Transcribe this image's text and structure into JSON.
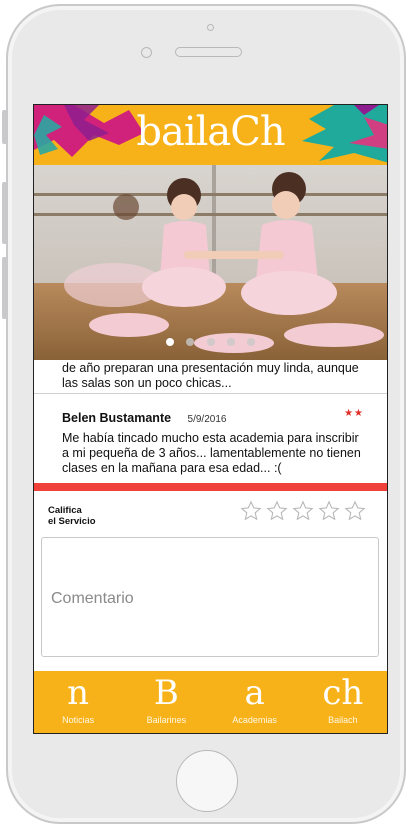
{
  "app": {
    "logo_text": "bailaCh",
    "brand_color": "#f7b219",
    "accent_red": "#f0413a"
  },
  "carousel": {
    "slides": 5,
    "active_index": 0
  },
  "reviews": {
    "previous_text": "de año preparan una presentación muy linda, aunque las salas son un poco chicas...",
    "latest": {
      "name": "Belen Bustamante",
      "date": "5/9/2016",
      "stars": "★★",
      "text": "Me había tincado mucho esta academia para inscribir a mi pequeña de 3 años... lamentablemente no tienen clases en la mañana para esa edad... :("
    }
  },
  "rating": {
    "label_line1": "Califica",
    "label_line2": "el Servicio",
    "max_stars": 5,
    "current": 0
  },
  "comment": {
    "placeholder": "Comentario"
  },
  "nav": {
    "items": [
      {
        "glyph": "n",
        "label": "Noticias"
      },
      {
        "glyph": "B",
        "label": "Bailarines"
      },
      {
        "glyph": "a",
        "label": "Academias"
      },
      {
        "glyph": "ch",
        "label": "Bailach"
      }
    ]
  }
}
